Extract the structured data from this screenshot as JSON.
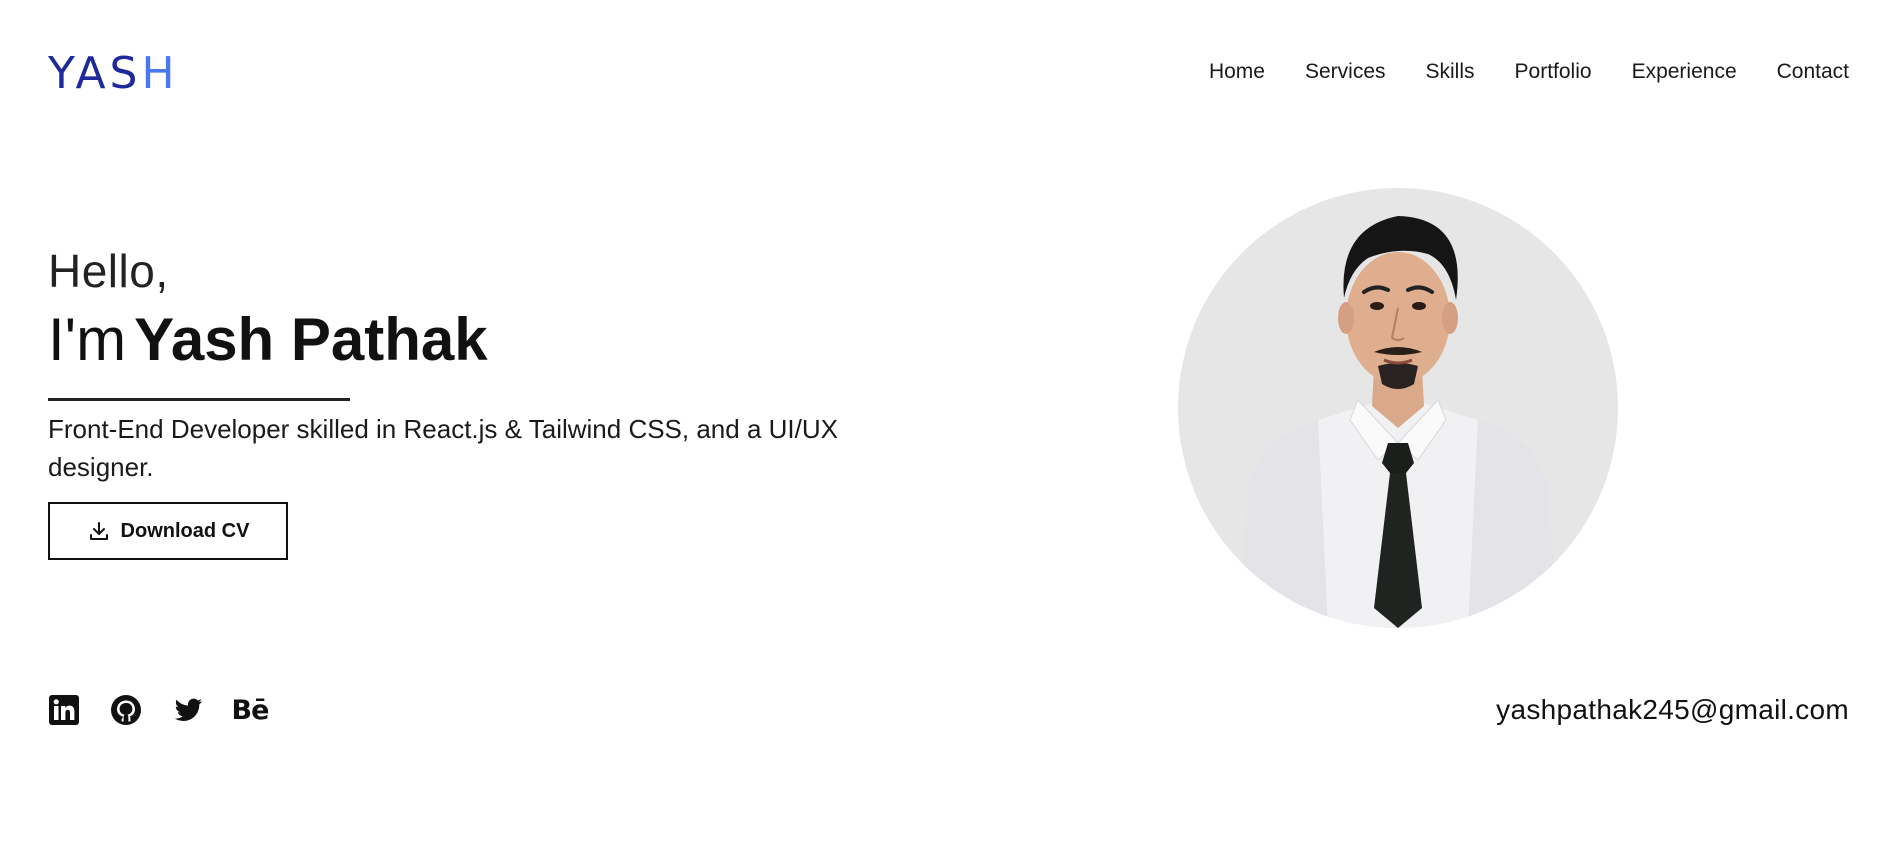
{
  "logo": {
    "part1": "YAS",
    "part2": "H"
  },
  "nav": {
    "items": [
      "Home",
      "Services",
      "Skills",
      "Portfolio",
      "Experience",
      "Contact"
    ]
  },
  "hero": {
    "greeting": "Hello,",
    "im": "I'm",
    "name": "Yash Pathak",
    "tagline": "Front-End Developer skilled in React.js & Tailwind CSS, and a UI/UX designer.",
    "cv_button": "Download CV"
  },
  "social": {
    "icons": [
      "linkedin-icon",
      "github-icon",
      "twitter-icon",
      "behance-icon"
    ],
    "behance_text": "Bē"
  },
  "contact": {
    "email": "yashpathak245@gmail.com"
  },
  "colors": {
    "logo_dark": "#1e2a9c",
    "logo_light": "#4a78ee",
    "portrait_bg": "#e6e6e6"
  }
}
